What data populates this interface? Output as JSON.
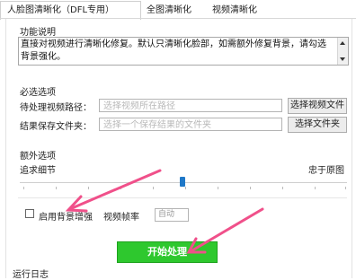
{
  "tabs": [
    {
      "label": "人脸图清晰化（DFL专用）"
    },
    {
      "label": "全图清晰化"
    },
    {
      "label": "视频清晰化"
    }
  ],
  "description": {
    "heading": "功能说明",
    "text": "直接对视频进行清晰化修复。默认只清晰化脸部，如需额外修复背景，请勾选背景强化。"
  },
  "required": {
    "heading": "必选选项",
    "video_label": "待处理视频路径：",
    "video_placeholder": "选择视频所在路径",
    "video_button": "选择视频文件",
    "output_label": "结果保存文件夹：",
    "output_placeholder": "选择一个保存结果的文件夹",
    "output_button": "选择文件夹"
  },
  "extra": {
    "heading": "额外选项",
    "detail_label": "追求细节",
    "fidelity_label": "忠于原图",
    "slider_value": 0.5,
    "bg_enhance_label": "启用背景增强",
    "bg_enhance_checked": false,
    "fps_label": "视频帧率",
    "fps_value": "自动"
  },
  "start_button": "开始处理",
  "log_heading": "运行日志",
  "colors": {
    "accent_green": "#2ec82e",
    "annotation_arrow": "#f0508a",
    "slider_thumb": "#1f78c8"
  }
}
